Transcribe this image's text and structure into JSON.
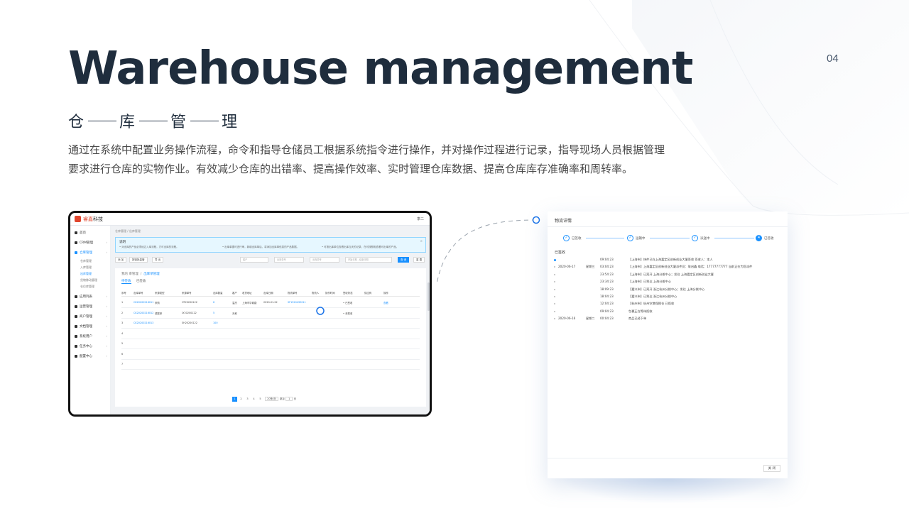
{
  "page": {
    "number": "04",
    "title_en": "Warehouse management",
    "title_cn": [
      "仓",
      "库",
      "管",
      "理"
    ],
    "description_line1": "通过在系统中配置业务操作流程，命令和指导仓储员工根据系统指令进行操作，并对操作过程进行记录，指导现场人员根据管理",
    "description_line2": "要求进行仓库的实物作业。有效减少仓库的出错率、提高操作效率、实时管理仓库数据、提高仓库库存准确率和周转率。"
  },
  "app": {
    "logo_brand": "睿嘉",
    "logo_suffix": "科技",
    "user": "李二",
    "breadcrumb": "仓库管理  /  出库管理",
    "sidebar": [
      {
        "label": "首页",
        "active": false
      },
      {
        "label": "CRM管理",
        "active": false
      },
      {
        "label": "仓库管理",
        "active": true
      },
      {
        "label": "应用列表",
        "active": false
      },
      {
        "label": "运营管理",
        "active": false
      },
      {
        "label": "商户管理",
        "active": false
      },
      {
        "label": "文档管理",
        "active": false
      },
      {
        "label": "系统用户",
        "active": false
      },
      {
        "label": "任务中心",
        "active": false
      },
      {
        "label": "配置中心",
        "active": false
      }
    ],
    "sidebar_sub": [
      {
        "label": "仓库管理",
        "active": false
      },
      {
        "label": "入库管理",
        "active": false
      },
      {
        "label": "出库管理",
        "active": true
      },
      {
        "label": "货物移动管理",
        "active": false
      },
      {
        "label": "仓位库管理",
        "active": false
      }
    ],
    "notice": {
      "title": "说明",
      "items": [
        "• 对出库的产品必须经过入库流程，方可出库的流程。",
        "• 出库单据可进行审，新增出库单后，将添加出库单信息的产品数据。",
        "• 可按出库单位查看出库当天的记录，在可按照相查看可出库的产品。"
      ],
      "close": "×"
    },
    "toolbar": {
      "btn_add": "添 加",
      "btn_batch": "按钮批量管",
      "btn_export": "导 出",
      "input1": "客户",
      "input2": "出库单号",
      "input3": "出库单号",
      "input4": "开始日期 - 结束日期",
      "btn_query": "查 询",
      "btn_reset": "重 置"
    },
    "content_title": "我的 审管理",
    "content_title_link": "出库单管理",
    "tabs": [
      "待签收",
      "已签收"
    ],
    "table": {
      "headers": [
        "序号",
        "出库单号",
        "来源类型",
        "来源单号",
        "出库数量",
        "客户",
        "收货地址",
        "出库日期",
        "物流单号",
        "物流人",
        "操作时间",
        "签收状态",
        "供应商",
        "操作"
      ],
      "rows": [
        [
          "1",
          "CK20200216011",
          "采购",
          "HT20200122",
          "6",
          "温杰",
          "上海市华城路",
          "2020-01-22",
          "SF1520439011",
          "",
          "",
          "• 已签收",
          "",
          "查看"
        ],
        [
          "2",
          "CK20200216012",
          "调拨单",
          "LY20200122",
          "5",
          "天和",
          "",
          "",
          "",
          "",
          "",
          "• 未签收",
          "",
          ""
        ],
        [
          "3",
          "CK20200216013",
          "",
          "SH20200122",
          "100",
          "",
          "",
          "",
          "",
          "",
          "",
          "",
          "",
          ""
        ],
        [
          "4",
          "",
          "",
          "",
          "",
          "",
          "",
          "",
          "",
          "",
          "",
          "",
          "",
          ""
        ],
        [
          "5",
          "",
          "",
          "",
          "",
          "",
          "",
          "",
          "",
          "",
          "",
          "",
          "",
          ""
        ],
        [
          "6",
          "",
          "",
          "",
          "",
          "",
          "",
          "",
          "",
          "",
          "",
          "",
          "",
          ""
        ],
        [
          "7",
          "",
          "",
          "",
          "",
          "",
          "",
          "",
          "",
          "",
          "",
          "",
          "",
          ""
        ]
      ]
    },
    "pager": {
      "pages": [
        "1",
        "2",
        "3",
        "4",
        "5"
      ],
      "size": "20条/页",
      "goto": "跳至",
      "goto_val": "1",
      "page_suffix": "页"
    }
  },
  "detail": {
    "title": "物流详情",
    "steps": [
      "已签收",
      "运输中",
      "派送中",
      "已签收"
    ],
    "status": "已签收",
    "timeline": [
      {
        "date": "",
        "week": "",
        "time": "09:04:23",
        "text": "【上海市】快件已在上海嘉定区创新创业大厦签收 签收人：本人",
        "active": true
      },
      {
        "date": "2020-06-17",
        "week": "星期三",
        "time": "03:04:23",
        "text": "【上海市】上海嘉定区创新创业大厦派件员：耿启鑫 电话：17777777777 当前正在为您派件",
        "active": false
      },
      {
        "date": "",
        "week": "",
        "time": "23:54:23",
        "text": "【上海市】已离开 上海分拨中心；发往 上海嘉定区创新创业大厦",
        "active": false
      },
      {
        "date": "",
        "week": "",
        "time": "23:34:23",
        "text": "【上海市】已到达 上海分拨中心",
        "active": false
      },
      {
        "date": "",
        "week": "",
        "time": "18:09:23",
        "text": "【嘉兴市】已离开 浙江杭州分拨中心；发往 上海分拨中心",
        "active": false
      },
      {
        "date": "",
        "week": "",
        "time": "18:04:23",
        "text": "【嘉兴市】已到达 浙江杭州分拨中心",
        "active": false
      },
      {
        "date": "",
        "week": "",
        "time": "12:04:23",
        "text": "【杭州市】杭州空港保税仓 已揽收",
        "active": false
      },
      {
        "date": "",
        "week": "",
        "time": "09:04:23",
        "text": "包裹正在等待揽收",
        "active": false
      },
      {
        "date": "2020-06-16",
        "week": "星期二",
        "time": "00:04:23",
        "text": "商品已经下单",
        "active": false
      }
    ],
    "close": "关 闭"
  },
  "colors": {
    "title": "#1f2d3d",
    "accent": "#1890ff",
    "brand_red": "#e0452d"
  }
}
